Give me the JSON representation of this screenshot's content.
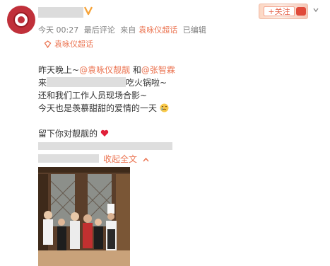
{
  "header": {
    "username": "",
    "vip_icon": "verified-v-icon",
    "meta": {
      "time": "今天 00:27",
      "comment_label": "最后评论",
      "from_label": "来自",
      "source": "袁咏仪超话",
      "edited": "已编辑"
    },
    "follow_label": "+关注",
    "chevron_icon": "chevron-down-icon"
  },
  "topic_tag": {
    "icon": "supertopic-icon",
    "label": "袁咏仪超话"
  },
  "post": {
    "line1_prefix": "昨天晚上~",
    "mention1": "@袁咏仪靓靓",
    "line1_mid": "和",
    "mention2": "@张智霖",
    "line2_prefix": "来",
    "line2_suffix": "吃火锅啦~",
    "line3": "还和我们工作人员现场合影~",
    "line4": "今天也是羡慕甜甜的爱情的一天",
    "line4_emoji": "crying-face-icon",
    "line5_prefix": "留下你对靓靓的",
    "line5_emoji": "red-heart-icon",
    "collapse_label": "收起全文",
    "collapse_icon": "chevron-up-icon"
  },
  "colors": {
    "accent": "#eb7350",
    "text": "#333333",
    "meta": "#808080"
  }
}
